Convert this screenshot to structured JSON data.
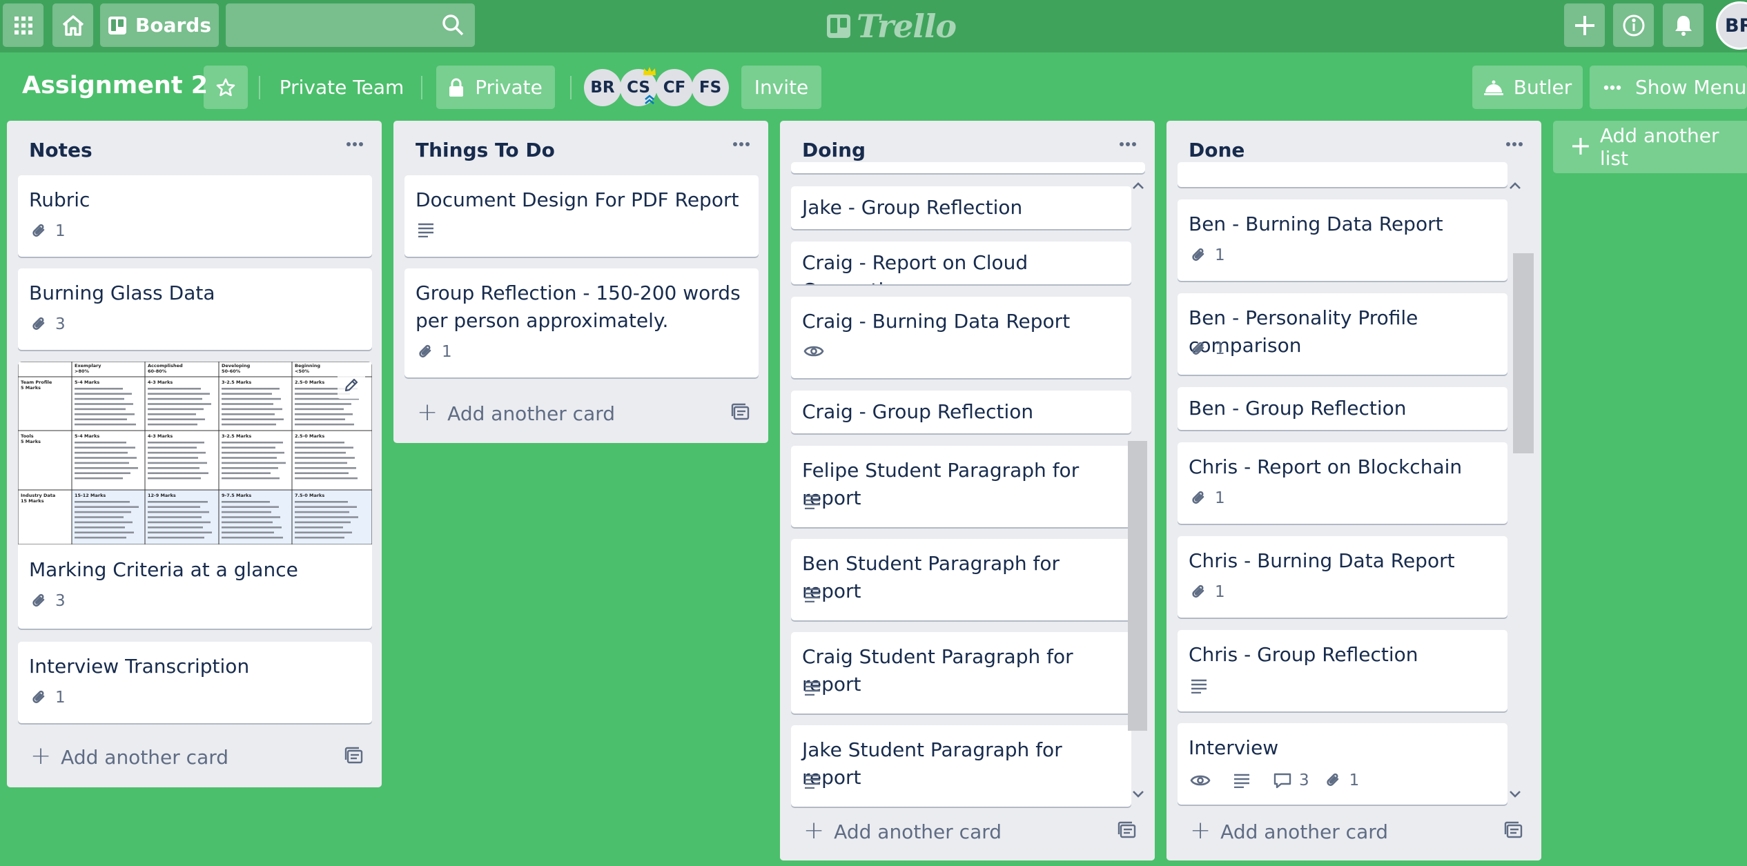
{
  "header": {
    "boards_label": "Boards",
    "search_placeholder": "",
    "logo_text": "Trello",
    "user_initials": "BR"
  },
  "board": {
    "title": "Assignment 2",
    "team_label": "Private Team",
    "visibility_label": "Private",
    "members": [
      "BR",
      "CS",
      "CF",
      "FS"
    ],
    "invite_label": "Invite",
    "butler_label": "Butler",
    "show_menu_label": "Show Menu"
  },
  "lists": [
    {
      "title": "Notes",
      "add_card_label": "Add another card",
      "cards": [
        {
          "title": "Rubric",
          "attachments": "1"
        },
        {
          "title": "Burning Glass Data",
          "attachments": "3"
        },
        {
          "title": "Marking Criteria at a glance",
          "attachments": "3",
          "cover": {
            "col_headers": [
              "Exemplary\n>80%",
              "Accomplished\n60-80%",
              "Developing\n50-60%",
              "Beginning\n<50%"
            ],
            "rows": [
              {
                "name": "Team Profile\n5 Marks",
                "cells": [
                  "5-4 Marks",
                  "4-3 Marks",
                  "3-2.5 Marks",
                  "2.5-0 Marks"
                ]
              },
              {
                "name": "Tools\n5 Marks",
                "cells": [
                  "5-4 Marks",
                  "4-3 Marks",
                  "3-2.5 Marks",
                  "2.5-0 Marks"
                ]
              },
              {
                "name": "Industry Data\n15 Marks",
                "cells": [
                  "15-12 Marks",
                  "12-9 Marks",
                  "9-7.5 Marks",
                  "7.5-0 Marks"
                ]
              }
            ]
          }
        },
        {
          "title": "Interview Transcription",
          "attachments": "1"
        }
      ]
    },
    {
      "title": "Things To Do",
      "add_card_label": "Add another card",
      "cards": [
        {
          "title": "Document Design For PDF Report"
        },
        {
          "title": "Group Reflection - 150-200 words per person approximately.",
          "attachments": "1"
        }
      ]
    },
    {
      "title": "Doing",
      "add_card_label": "Add another card",
      "cards": [
        {
          "title": "Jake - Group Reflection"
        },
        {
          "title": "Craig - Report on Cloud Computing"
        },
        {
          "title": "Craig - Burning Data Report"
        },
        {
          "title": "Craig - Group Reflection"
        },
        {
          "title": "Felipe Student Paragraph for report"
        },
        {
          "title": "Ben Student Paragraph for report"
        },
        {
          "title": "Craig Student Paragraph for report"
        },
        {
          "title": "Jake Student Paragraph for report"
        }
      ]
    },
    {
      "title": "Done",
      "add_card_label": "Add another card",
      "cards": [
        {
          "title": "Ben - Burning Data Report",
          "attachments": "1"
        },
        {
          "title": "Ben - Personality Profile comparison",
          "attachments": "1"
        },
        {
          "title": "Ben - Group Reflection"
        },
        {
          "title": "Chris - Report on Blockchain",
          "attachments": "1"
        },
        {
          "title": "Chris - Burning Data Report",
          "attachments": "1"
        },
        {
          "title": "Chris - Group Reflection"
        },
        {
          "title": "Interview",
          "comments": "3",
          "attachments": "1"
        }
      ]
    }
  ],
  "add_list_label": "Add another list",
  "colors": {
    "board_bg": "#4bbf6b",
    "header_bg": "#3fa35c",
    "list_bg": "#ebecf0",
    "card_bg": "#ffffff",
    "text": "#172b4d",
    "muted": "#5e6c84"
  }
}
